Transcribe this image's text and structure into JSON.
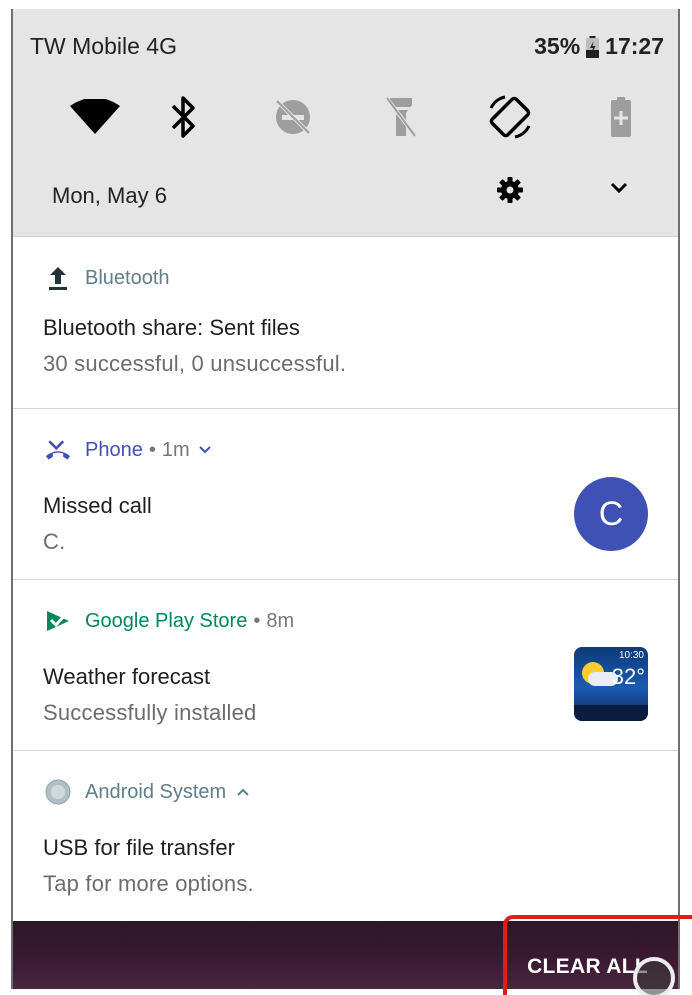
{
  "status_bar": {
    "carrier": "TW Mobile 4G",
    "battery": "35%",
    "time": "17:27"
  },
  "quick_settings": {
    "tiles": [
      "wifi-icon",
      "bluetooth-icon",
      "do-not-disturb-icon",
      "flashlight-icon",
      "auto-rotate-icon",
      "battery-saver-icon"
    ],
    "date": "Mon, May 6"
  },
  "notifications": [
    {
      "app": "Bluetooth",
      "title": "Bluetooth share: Sent files",
      "text": "30 successful, 0 unsuccessful.",
      "color": "#607d8b"
    },
    {
      "app": "Phone",
      "time": "1m",
      "title": "Missed call",
      "text": "C.",
      "avatar": "C",
      "color": "#3f51b5"
    },
    {
      "app": "Google Play Store",
      "time": "8m",
      "title": "Weather forecast",
      "text": "Successfully installed",
      "color": "#01875f",
      "thumbnail": {
        "time": "10:30",
        "temp": "32°"
      }
    },
    {
      "app": "Android System",
      "title": "USB for file transfer",
      "text": "Tap for more options.",
      "color": "#607d8b"
    }
  ],
  "footer": {
    "clear_all": "CLEAR ALL"
  },
  "colors": {
    "highlight": "#e21b1b"
  }
}
